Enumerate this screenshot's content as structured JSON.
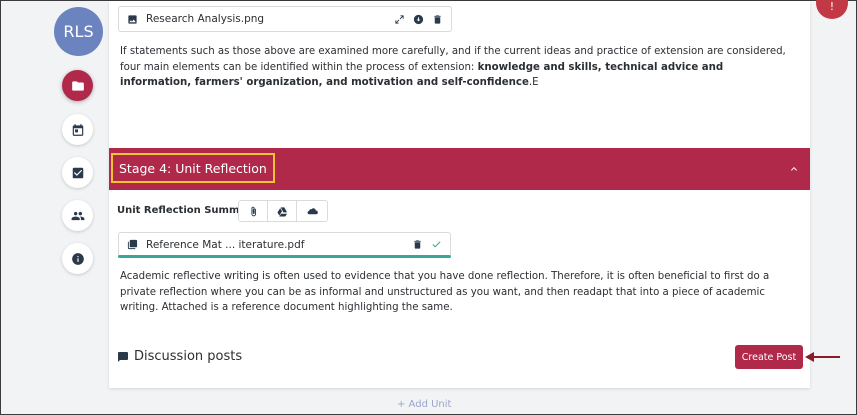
{
  "sidebar": {
    "avatar_initials": "RLS",
    "items": [
      {
        "icon": "folder-icon",
        "active": true
      },
      {
        "icon": "calendar-icon",
        "active": false
      },
      {
        "icon": "checkbox-icon",
        "active": false
      },
      {
        "icon": "people-icon",
        "active": false
      },
      {
        "icon": "info-icon",
        "active": false
      }
    ]
  },
  "top_badge": {
    "label": "!"
  },
  "attachment_top": {
    "name": "Research Analysis.png"
  },
  "paragraph1": {
    "lead": "If statements such as those above are examined more carefully, and if the current ideas and practice of extension are considered, four main elements can be identified within the process of extension: ",
    "bold": "knowledge and skills, technical advice and information, farmers' organization, and motivation and self-confidence",
    "tail": ".E"
  },
  "stage": {
    "title": "Stage 4: Unit Reflection"
  },
  "reflection": {
    "summary_label": "Unit Reflection Summary",
    "attach_buttons": [
      "paperclip-icon",
      "google-drive-icon",
      "onedrive-icon"
    ],
    "file": {
      "name": "Reference Mat ... iterature.pdf",
      "upload_progress": 1.0
    },
    "paragraph": "Academic reflective writing is often used to evidence that you have done reflection. Therefore, it is often beneficial to first do a private reflection where you can be as informal and unstructured as you want, and then readapt that into a piece of academic writing. Attached is a reference document highlighting the same."
  },
  "discussion": {
    "label": "Discussion posts",
    "create_button": "Create Post"
  },
  "add_unit": {
    "label": "+ Add Unit"
  },
  "colors": {
    "accent": "#b0294b",
    "highlight": "#f2c230",
    "progress": "#39a89a",
    "avatar": "#6b84bf"
  }
}
